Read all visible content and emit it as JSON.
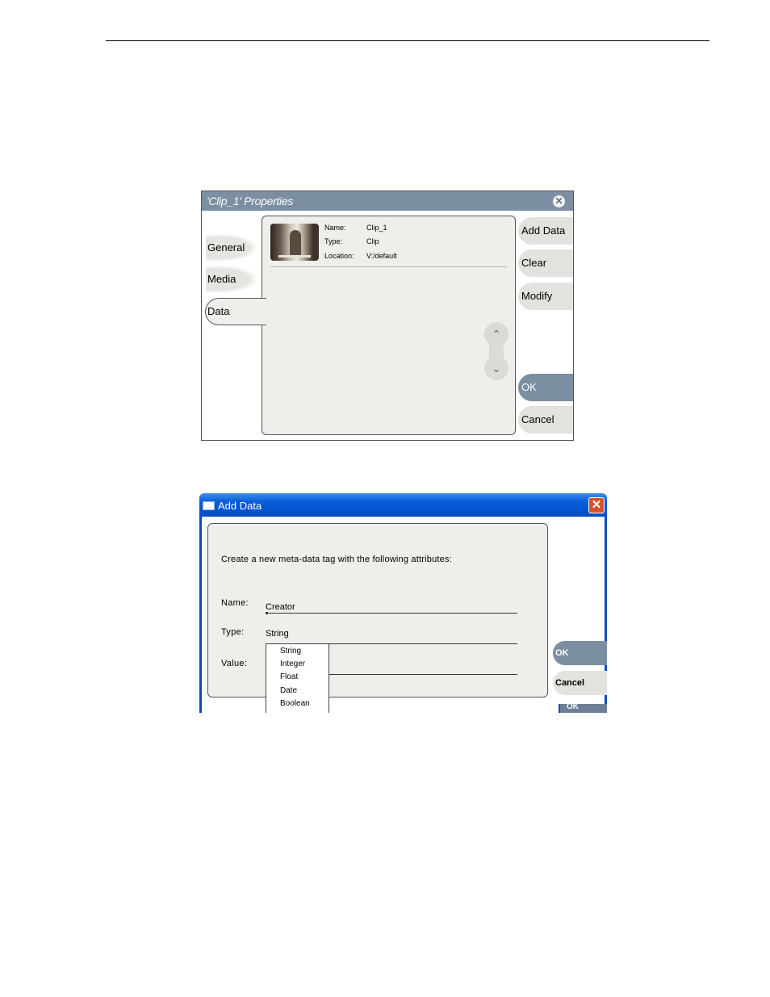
{
  "properties_dialog": {
    "title": "'Clip_1' Properties",
    "close_glyph": "✕",
    "tabs": [
      {
        "label": "General"
      },
      {
        "label": "Media"
      },
      {
        "label": "Data"
      }
    ],
    "active_tab": "Data",
    "clip_info": {
      "name_label": "Name:",
      "name_value": "Clip_1",
      "type_label": "Type:",
      "type_value": "Clip",
      "location_label": "Location:",
      "location_value": "V:/default"
    },
    "scroll_up_glyph": "⌃",
    "scroll_down_glyph": "⌄",
    "buttons": {
      "add_data": "Add Data",
      "clear": "Clear",
      "modify": "Modify",
      "ok": "OK",
      "cancel": "Cancel"
    },
    "colors": {
      "titlebar": "#7b8ea2",
      "panel": "#efeeea"
    }
  },
  "add_data_window": {
    "title": "Add Data",
    "close_glyph": "✕",
    "prompt": "Create a new meta-data tag with the following attributes:",
    "fields": {
      "name_label": "Name:",
      "name_value": "Creator",
      "type_label": "Type:",
      "type_value": "String",
      "value_label": "Value:"
    },
    "type_options": [
      "String",
      "Integer",
      "Float",
      "Date",
      "Boolean"
    ],
    "buttons": {
      "ok": "OK",
      "cancel": "Cancel"
    },
    "underlying_button": "OK",
    "colors": {
      "titlebar": "#0453d0",
      "close": "#d9512c"
    }
  }
}
